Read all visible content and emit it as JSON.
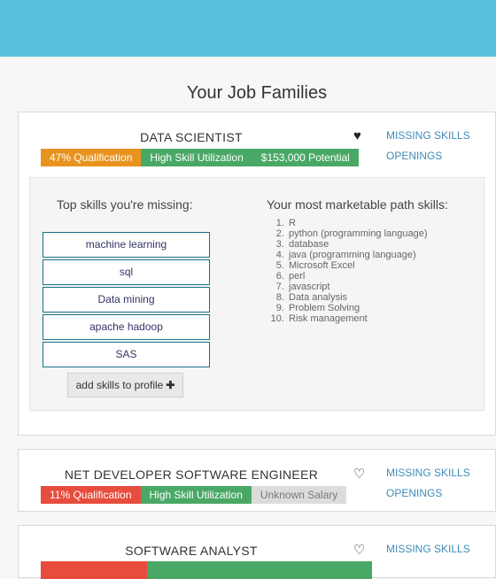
{
  "page": {
    "title": "Your Job Families"
  },
  "cards": [
    {
      "job_title": "DATA SCIENTIST",
      "qualification": "47% Qualification",
      "utilization": "High Skill Utilization",
      "salary": "$153,000 Potential",
      "favorite": true,
      "links": {
        "missing_skills": "MISSING SKILLS",
        "openings": "OPENINGS"
      },
      "missing_heading": "Top skills you're missing:",
      "missing_skills": [
        "machine learning",
        "sql",
        "Data mining",
        "apache hadoop",
        "SAS"
      ],
      "add_button": "add skills to profile",
      "marketable_heading": "Your most marketable path skills:",
      "marketable_skills": [
        "R",
        "python (programming language)",
        "database",
        "java (programming language)",
        "Microsoft Excel",
        "perl",
        "javascript",
        "Data analysis",
        "Problem Solving",
        "Risk management"
      ]
    },
    {
      "job_title": "NET DEVELOPER SOFTWARE ENGINEER",
      "qualification": "11% Qualification",
      "utilization": "High Skill Utilization",
      "salary": "Unknown Salary",
      "favorite": false,
      "links": {
        "missing_skills": "MISSING SKILLS",
        "openings": "OPENINGS"
      }
    },
    {
      "job_title": "SOFTWARE ANALYST",
      "favorite": false,
      "links": {
        "missing_skills": "MISSING SKILLS"
      }
    }
  ],
  "colors": {
    "header": "#5bc0de",
    "qualification_high": "#e8931e",
    "qualification_low": "#e74c3c",
    "green": "#4aa866",
    "link": "#3d8bb8"
  },
  "icons": {
    "favorite_on": "heart-filled-icon",
    "favorite_off": "heart-outline-icon",
    "add": "plus-icon"
  }
}
